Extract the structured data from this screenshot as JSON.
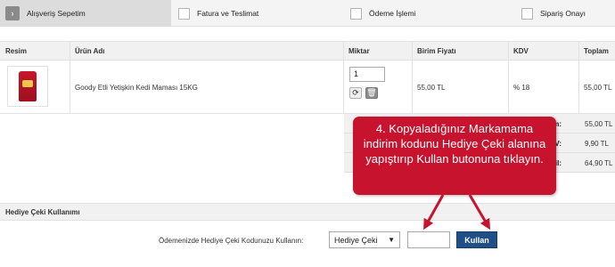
{
  "steps": {
    "step1": "Alışveriş Sepetim",
    "step2": "Fatura ve Teslimat",
    "step3": "Ödeme İşlemi",
    "step4": "Sipariş Onayı"
  },
  "table": {
    "headers": {
      "image": "Resim",
      "name": "Ürün Adı",
      "qty": "Miktar",
      "unit_price": "Birim Fiyatı",
      "vat": "KDV",
      "total": "Toplam"
    },
    "row": {
      "name": "Goody Etli Yetişkin Kedi Maması 15KG",
      "qty": "1",
      "unit_price": "55,00 TL",
      "vat": "% 18",
      "total": "55,00 TL"
    }
  },
  "totals": {
    "subtotal_label": "Toplam:",
    "subtotal_value": "55,00 TL",
    "vat_label": "KDV:",
    "vat_value": "9,90 TL",
    "grand_label": "Dahil:",
    "grand_value": "64,90 TL"
  },
  "gift": {
    "section_title": "Hediye Çeki Kullanımı",
    "label": "Ödemenizde Hediye Çeki Kodunuzu Kullanın:",
    "select_value": "Hediye Çeki",
    "apply_label": "Kullan"
  },
  "callout": {
    "text": "4. Kopyaladığınız Markamama indirim kodunu Hediye Çeki alanına yapıştırıp Kullan butonuna tıklayın."
  },
  "colors": {
    "callout": "#c8132f",
    "apply_button": "#1f4f86"
  },
  "icons": [
    "chevron-right-icon",
    "refresh-icon",
    "trash-icon",
    "dropdown-arrow-icon"
  ]
}
